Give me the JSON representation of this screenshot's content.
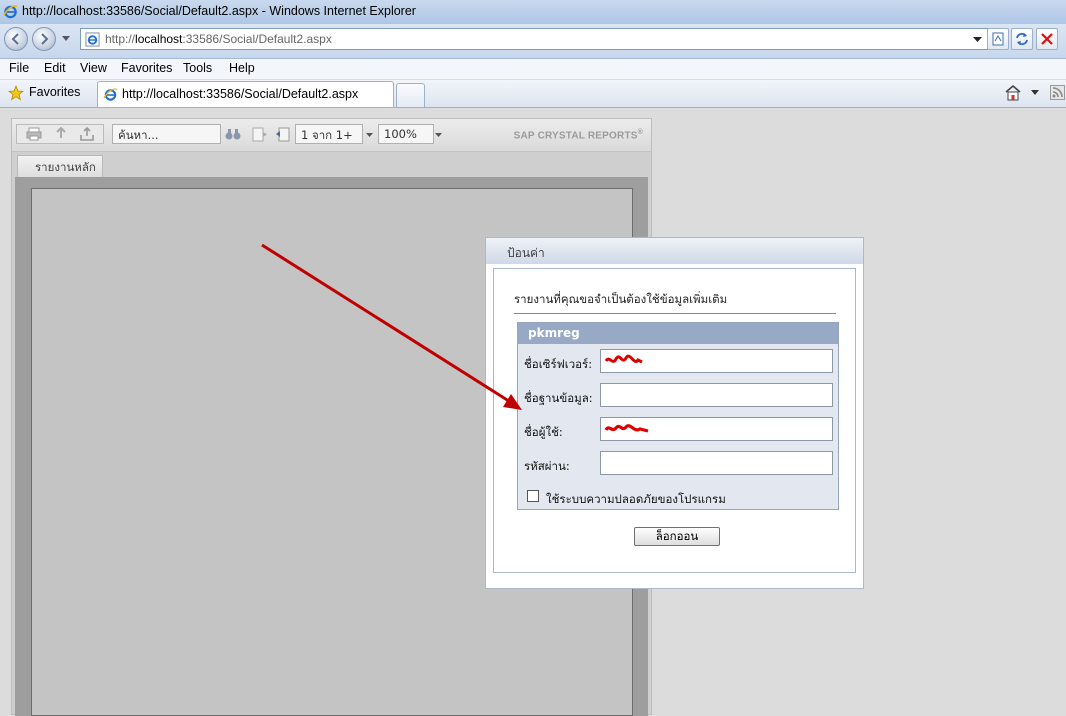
{
  "window": {
    "title": "http://localhost:33586/Social/Default2.aspx - Windows Internet Explorer"
  },
  "address_bar": {
    "url_prefix": "http://",
    "url_host": "localhost",
    "url_rest": ":33586/Social/Default2.aspx"
  },
  "menu": {
    "items": [
      "File",
      "Edit",
      "View",
      "Favorites",
      "Tools",
      "Help"
    ]
  },
  "favorites_bar": {
    "favorites_label": "Favorites",
    "tab_title": "http://localhost:33586/Social/Default2.aspx"
  },
  "viewer": {
    "search_placeholder": "ค้นหา...",
    "page_indicator": "1 จาก 1+",
    "zoom": "100%",
    "brand": "SAP CRYSTAL REPORTS",
    "main_tab": "รายงานหลัก"
  },
  "dialog": {
    "title": "ป้อนค่า",
    "message": "รายงานที่คุณขอจำเป็นต้องใช้ข้อมูลเพิ่มเติม",
    "connection_name": "pkmreg",
    "fields": {
      "server_label": "ชื่อเซิร์ฟเวอร์:",
      "database_label": "ชื่อฐานข้อมูล:",
      "user_label": "ชื่อผู้ใช้:",
      "password_label": "รหัสผ่าน:"
    },
    "integrated_security_label": "ใช้ระบบความปลอดภัยของโปรแกรม",
    "integrated_security_checked": false,
    "logon_button": "ล็อกออน"
  },
  "colors": {
    "arrow": "#c00000",
    "redaction": "#e00000",
    "panel_header": "#97a9c4"
  }
}
